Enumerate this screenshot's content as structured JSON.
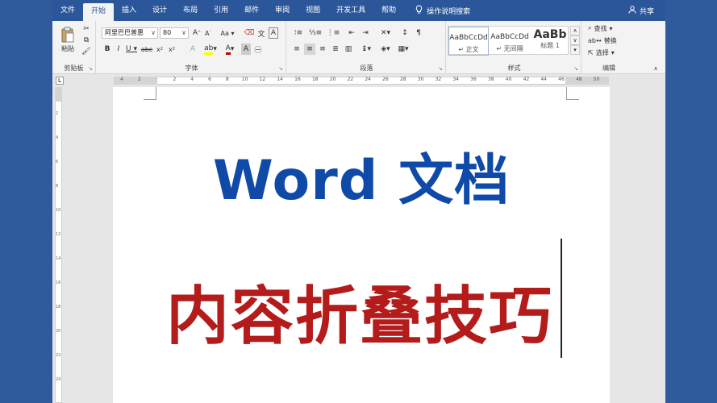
{
  "tabs": [
    "文件",
    "开始",
    "插入",
    "设计",
    "布局",
    "引用",
    "邮件",
    "审阅",
    "视图",
    "开发工具",
    "帮助"
  ],
  "active_tab": "开始",
  "tell_me": "操作说明搜索",
  "share": "共享",
  "clipboard": {
    "paste": "粘贴",
    "label": "剪贴板"
  },
  "font": {
    "name": "阿里巴巴普惠",
    "size": "80",
    "label": "字体"
  },
  "paragraph": {
    "label": "段落"
  },
  "styles": {
    "label": "样式",
    "items": [
      {
        "sample": "AaBbCcDd",
        "name": "↵ 正文"
      },
      {
        "sample": "AaBbCcDd",
        "name": "↵ 无间隔"
      },
      {
        "sample": "AaBb",
        "name": "标题 1"
      }
    ]
  },
  "editing": {
    "find": "查找",
    "replace": "替换",
    "select": "选择",
    "label": "编辑"
  },
  "ruler_ticks": [
    "4",
    "2",
    "",
    "2",
    "4",
    "6",
    "8",
    "10",
    "12",
    "14",
    "16",
    "18",
    "20",
    "22",
    "24",
    "26",
    "28",
    "30",
    "32",
    "34",
    "36",
    "38",
    "40",
    "42",
    "44",
    "46",
    "48",
    "50"
  ],
  "vruler_ticks": [
    "2",
    "4",
    "6",
    "8",
    "10",
    "12",
    "14",
    "16",
    "18",
    "20",
    "22",
    "24"
  ],
  "document": {
    "line1": "Word 文档",
    "line2": "内容折叠技巧"
  }
}
